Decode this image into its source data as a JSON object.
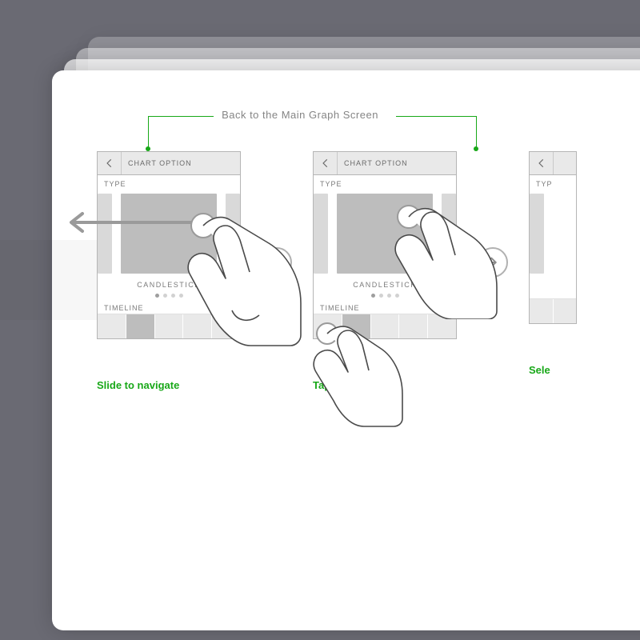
{
  "annotation": "Back to the Main Graph Screen",
  "accent": "#18a818",
  "screen": {
    "title": "CHART OPTION",
    "section_type": "TYPE",
    "chart_name": "CANDLESTICK",
    "section_timeline": "TIMELINE"
  },
  "captions": {
    "slide": "Slide to navigate",
    "tap": "Tap to select",
    "third": "Sele"
  }
}
